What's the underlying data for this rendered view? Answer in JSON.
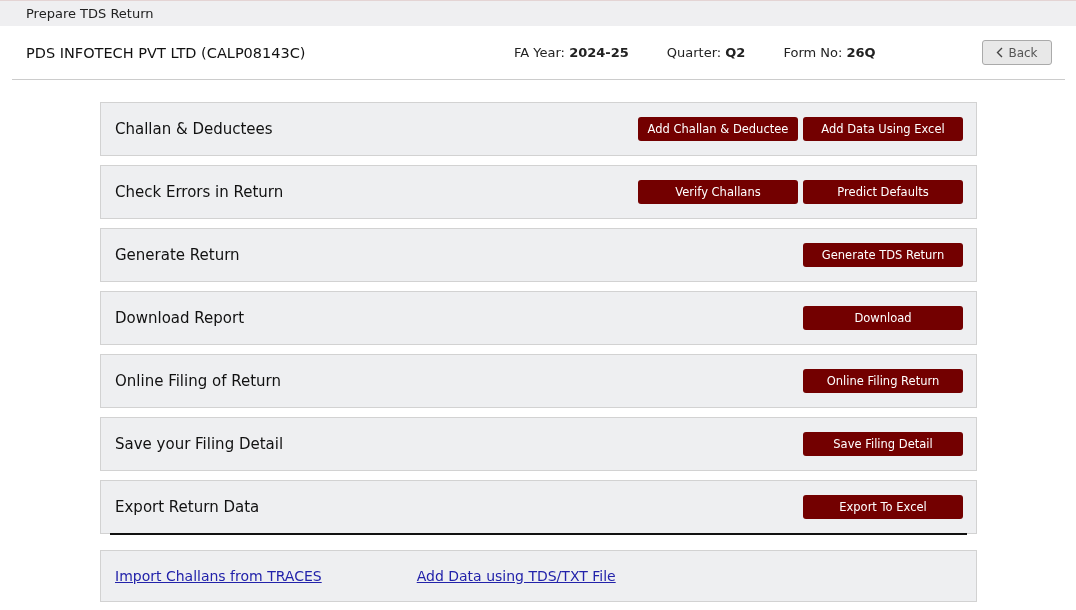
{
  "window": {
    "title": "Prepare TDS Return"
  },
  "header": {
    "company": "PDS INFOTECH PVT LTD (CALP08143C)",
    "fields": [
      {
        "label": "FA Year:",
        "value": "2024-25"
      },
      {
        "label": "Quarter:",
        "value": "Q2"
      },
      {
        "label": "Form No:",
        "value": "26Q"
      }
    ],
    "back_button": "Back"
  },
  "sections": [
    {
      "title": "Challan & Deductees",
      "buttons": [
        "Add Challan & Deductee",
        "Add Data Using Excel"
      ]
    },
    {
      "title": "Check Errors in Return",
      "buttons": [
        "Verify Challans",
        "Predict Defaults"
      ]
    },
    {
      "title": "Generate Return",
      "buttons": [
        "Generate TDS Return"
      ]
    },
    {
      "title": "Download Report",
      "buttons": [
        "Download"
      ]
    },
    {
      "title": "Online Filing of Return",
      "buttons": [
        "Online Filing Return"
      ]
    },
    {
      "title": "Save your Filing Detail",
      "buttons": [
        "Save Filing Detail"
      ]
    },
    {
      "title": "Export Return Data",
      "buttons": [
        "Export To Excel"
      ]
    }
  ],
  "links": [
    "Import Challans from TRACES",
    "Add Data using TDS/TXT File"
  ]
}
